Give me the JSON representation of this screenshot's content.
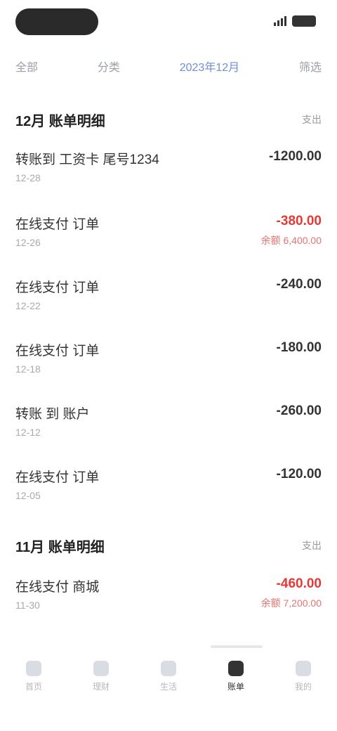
{
  "status_bar": {
    "time": "",
    "icons": [
      "signal-icon",
      "battery-icon"
    ]
  },
  "filters": {
    "items": [
      {
        "label": "全部"
      },
      {
        "label": "分类"
      },
      {
        "label": "2023年12月",
        "active": true
      },
      {
        "label": "筛选"
      }
    ]
  },
  "sections": [
    {
      "title": "12月 账单明细",
      "sub": "支出",
      "rows": [
        {
          "title": "转账到 工资卡 尾号1234",
          "subtitle": "12-28",
          "amount": "-1200.00",
          "note": ""
        },
        {
          "title": "在线支付 订单",
          "subtitle": "12-26",
          "amount": "-380.00",
          "note": "余额 6,400.00",
          "red": true
        },
        {
          "title": "在线支付 订单",
          "subtitle": "12-22",
          "amount": "-240.00",
          "note": ""
        },
        {
          "title": "在线支付 订单",
          "subtitle": "12-18",
          "amount": "-180.00",
          "note": ""
        },
        {
          "title": "转账 到 账户",
          "subtitle": "12-12",
          "amount": "-260.00",
          "note": ""
        },
        {
          "title": "在线支付 订单",
          "subtitle": "12-05",
          "amount": "-120.00",
          "note": ""
        }
      ]
    },
    {
      "title": "11月 账单明细",
      "sub": "支出",
      "rows": [
        {
          "title": "在线支付 商城",
          "subtitle": "11-30",
          "amount": "-460.00",
          "note": "余额 7,200.00",
          "red": true
        }
      ]
    }
  ],
  "bottom_nav": {
    "items": [
      {
        "label": "首页",
        "icon": "home-icon"
      },
      {
        "label": "理财",
        "icon": "wallet-icon"
      },
      {
        "label": "生活",
        "icon": "grid-icon"
      },
      {
        "label": "账单",
        "icon": "bill-icon",
        "active": true
      },
      {
        "label": "我的",
        "icon": "user-icon"
      }
    ]
  }
}
